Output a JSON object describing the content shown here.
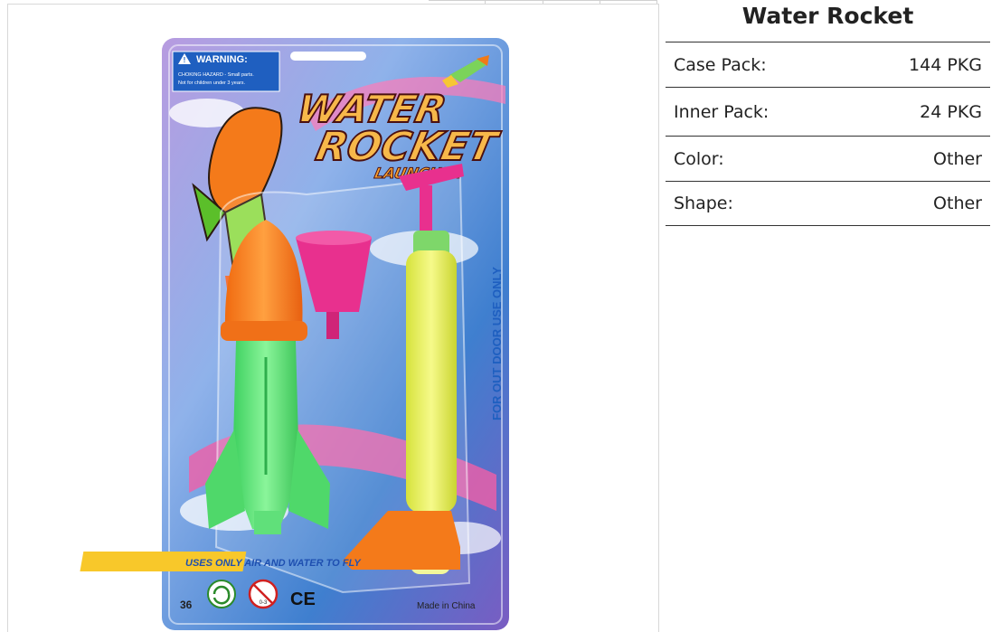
{
  "product": {
    "title": "Water Rocket",
    "specs": [
      {
        "label": "Case Pack:",
        "value": "144 PKG"
      },
      {
        "label": "Inner Pack:",
        "value": "24 PKG"
      },
      {
        "label": "Color:",
        "value": "Other"
      },
      {
        "label": "Shape:",
        "value": "Other"
      }
    ]
  },
  "package": {
    "warning_title": "WARNING:",
    "warning_line1": "CHOKING HAZARD - Small parts.",
    "warning_line2": "Not for children under 3 years.",
    "logo_word1": "WATER",
    "logo_word2": "ROCKET",
    "logo_word3": "LAUNCHER",
    "side_text": "FOR OUT DOOR USE ONLY",
    "bottom_banner": "USES ONLY AIR AND WATER TO FLY",
    "item_number": "36",
    "age_mark": "0-3",
    "ce_mark": "CE",
    "origin": "Made in China",
    "colors": {
      "card_blue": "#3f7fcf",
      "card_purple": "#9c8ad0",
      "rocket_orange": "#f07a18",
      "rocket_green": "#5ee07a",
      "cup_pink": "#e8308e",
      "pump_yellow": "#eef25a"
    }
  }
}
